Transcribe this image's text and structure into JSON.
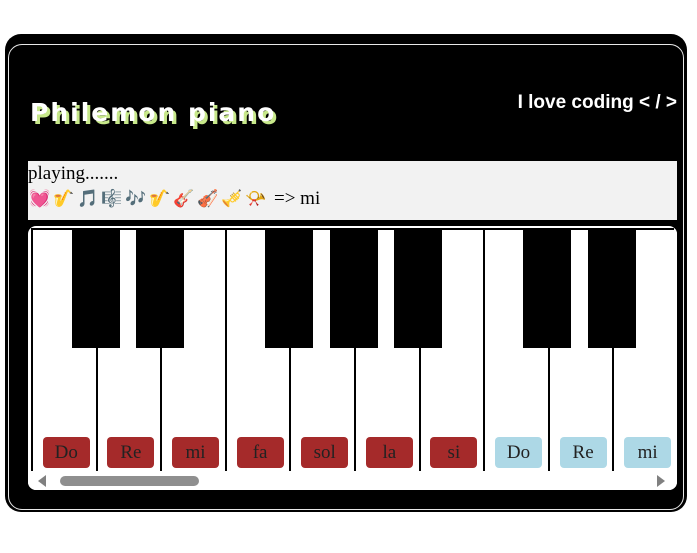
{
  "header": {
    "title": "Philemon piano",
    "tagline": "I love coding < / >"
  },
  "status": {
    "playing_text": "playing.......",
    "emojis": [
      "💓",
      "🎷",
      "🎵",
      "🎼",
      "🎶",
      "🎷",
      "🎸",
      "🎻",
      "🎺",
      "📯"
    ],
    "current_note_text": "=> mi"
  },
  "piano": {
    "white_keys": [
      {
        "label": "Do",
        "color": "#a52a2a"
      },
      {
        "label": "Re",
        "color": "#a52a2a"
      },
      {
        "label": "mi",
        "color": "#a52a2a"
      },
      {
        "label": "fa",
        "color": "#a52a2a"
      },
      {
        "label": "sol",
        "color": "#a52a2a"
      },
      {
        "label": "la",
        "color": "#a52a2a"
      },
      {
        "label": "si",
        "color": "#a52a2a"
      },
      {
        "label": "Do",
        "color": "#add8e6"
      },
      {
        "label": "Re",
        "color": "#add8e6"
      },
      {
        "label": "mi",
        "color": "#add8e6"
      }
    ],
    "black_key_count": 7
  },
  "colors": {
    "background": "#000000",
    "title_shadow": "#c7e88a",
    "octave1_label": "#a52a2a",
    "octave2_label": "#add8e6"
  }
}
